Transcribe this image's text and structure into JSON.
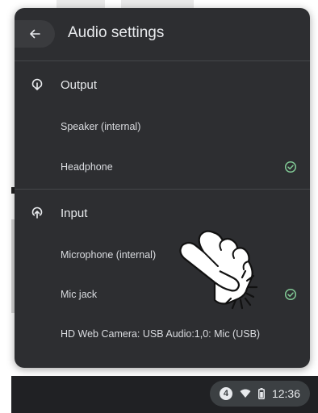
{
  "panel": {
    "title": "Audio settings",
    "back_icon": "arrow-back-icon"
  },
  "output": {
    "label": "Output",
    "icon": "speaker-output-icon",
    "devices": [
      {
        "label": "Speaker (internal)",
        "selected": false
      },
      {
        "label": "Headphone",
        "selected": true
      }
    ]
  },
  "input": {
    "label": "Input",
    "icon": "mic-input-icon",
    "devices": [
      {
        "label": "Microphone (internal)",
        "selected": false
      },
      {
        "label": "Mic jack",
        "selected": true
      },
      {
        "label": "HD Web Camera: USB Audio:1,0: Mic (USB)",
        "selected": false
      }
    ]
  },
  "status_tray": {
    "notification_count": "4",
    "time": "12:36",
    "icons": [
      "wifi-icon",
      "battery-icon"
    ]
  },
  "colors": {
    "panel_bg": "#2d2e31",
    "text": "#e8eaed",
    "check": "#81c995",
    "shelf_bg": "#202124"
  }
}
